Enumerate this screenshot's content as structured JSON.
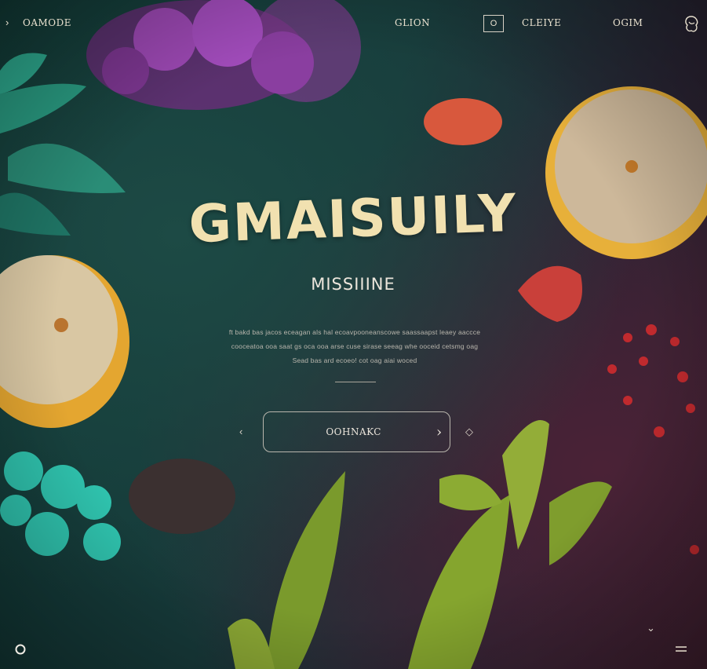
{
  "nav": {
    "left_label": "OAMODE",
    "items": [
      "GLION",
      "CLEIYE",
      "OGIM"
    ],
    "box_label": "O"
  },
  "hero": {
    "brand": "GMAISUILY",
    "subtitle": "MISSIIINE",
    "paragraph": "ft bakd bas jacos eceagan als hal ecoavpooneanscowe saassaapst leaey aaccce cooceatoa ooa saat gs oca ooa arse cuse  sirase seeag whe ooceid cetsmg oag Sead bas ard ecoeo! cot oag aiai woced",
    "cta_label": "OOHNAKC"
  },
  "colors": {
    "background": "#173a3a",
    "text_primary": "#f1e1b0",
    "teal_accent": "#3cc7b3",
    "purple_accent": "#9a3fb0"
  },
  "icons": {
    "nav_left": "chevron-right-icon",
    "top_right": "flower-logo-icon",
    "cta": "chevron-right-icon",
    "bottom_left": "circle-icon",
    "bottom_right": "menu-icon",
    "scroll": "chevron-down-icon"
  }
}
